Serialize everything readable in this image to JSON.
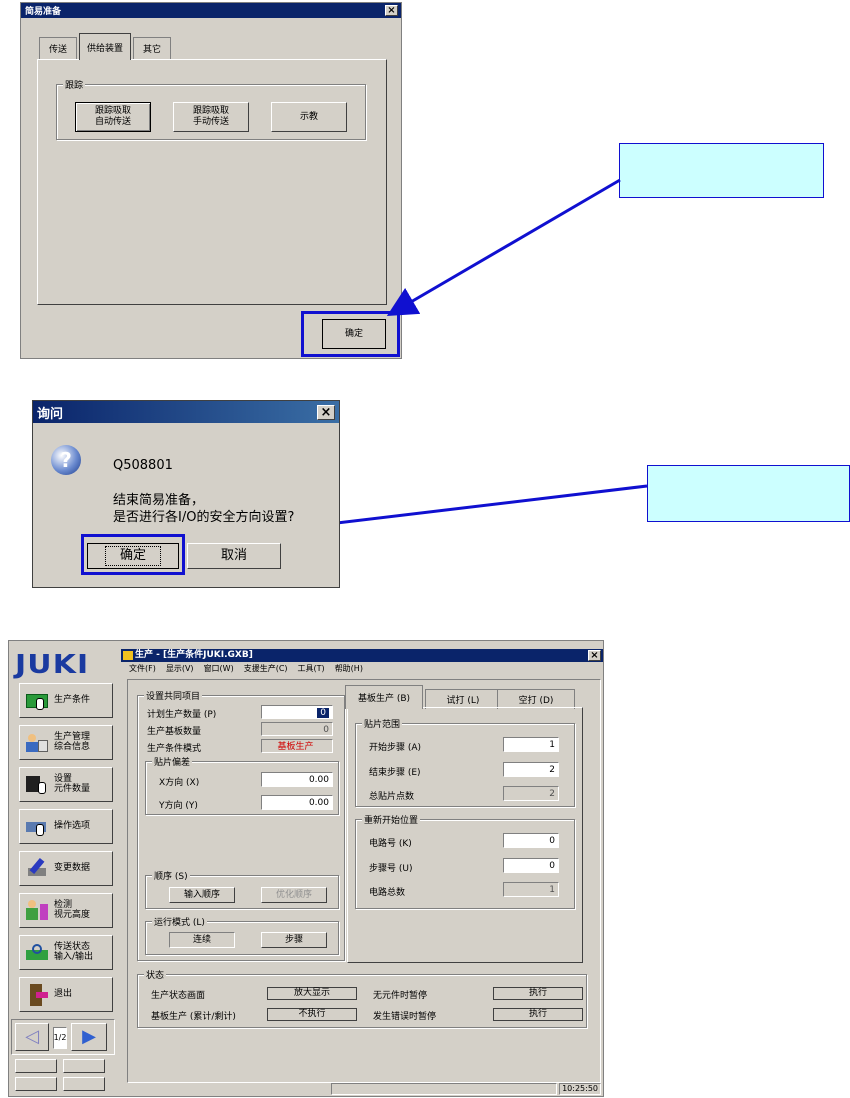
{
  "colors": {
    "title_bar": "#0a246a",
    "highlight": "#1010d0",
    "callout_bg": "#ccffff",
    "red_value": "#d00000"
  },
  "dialog1": {
    "title": "简易准备",
    "close": "×",
    "tabs": [
      "传送",
      "供给装置",
      "其它"
    ],
    "group_title": "跟踪",
    "buttons": [
      {
        "line1": "跟踪吸取",
        "line2": "自动传送"
      },
      {
        "line1": "跟踪吸取",
        "line2": "手动传送"
      },
      {
        "line1": "示教",
        "line2": ""
      }
    ],
    "ok_label": "确定"
  },
  "dialog2": {
    "title": "询问",
    "close": "×",
    "code": "Q508801",
    "message_line1": "结束简易准备，",
    "message_line2": "是否进行各I/O的安全方向设置?",
    "ok_label": "确定",
    "cancel_label": "取消",
    "question_icon": "?"
  },
  "main": {
    "logo": "JUKI",
    "title": "生产 - [生产条件JUKI.GXB]",
    "close": "×",
    "menu": [
      "文件(F)",
      "显示(V)",
      "窗口(W)",
      "支援生产(C)",
      "工具(T)",
      "帮助(H)"
    ],
    "sidebar": [
      {
        "label1": "生产条件",
        "label2": "",
        "icon": "production-icon"
      },
      {
        "label1": "生产管理",
        "label2": "综合信息",
        "icon": "management-icon"
      },
      {
        "label1": "设置",
        "label2": "元件数量",
        "icon": "parts-count-icon"
      },
      {
        "label1": "操作选项",
        "label2": "",
        "icon": "hand-option-icon"
      },
      {
        "label1": "变更数据",
        "label2": "",
        "icon": "edit-data-icon"
      },
      {
        "label1": "检测",
        "label2": "视元高度",
        "icon": "height-check-icon"
      },
      {
        "label1": "传送状态",
        "label2": "输入/输出",
        "icon": "io-status-icon"
      },
      {
        "label1": "退出",
        "label2": "",
        "icon": "exit-door-icon"
      }
    ],
    "page_indicator": "1/2",
    "common": {
      "title": "设置共同项目",
      "rows": [
        {
          "label": "计划生产数量 (P)",
          "value": "0"
        },
        {
          "label": "生产基板数量",
          "value": "0"
        },
        {
          "label": "生产条件模式",
          "value": "基板生产"
        }
      ]
    },
    "offset": {
      "title": "贴片偏差",
      "x_label": "X方向 (X)",
      "x_value": "0.00",
      "y_label": "Y方向 (Y)",
      "y_value": "0.00"
    },
    "order": {
      "title": "顺序 (S)",
      "input_label": "输入顺序",
      "optimize_label": "优化顺序"
    },
    "mode": {
      "title": "运行模式 (L)",
      "continuous": "连续",
      "step": "步骤"
    },
    "tabs": [
      "基板生产 (B)",
      "试打 (L)",
      "空打 (D)"
    ],
    "range": {
      "title": "贴片范围",
      "rows": [
        {
          "label": "开始步骤 (A)",
          "value": "1"
        },
        {
          "label": "结束步骤 (E)",
          "value": "2"
        },
        {
          "label": "总贴片点数",
          "value": "2"
        }
      ]
    },
    "restart": {
      "title": "重新开始位置",
      "rows": [
        {
          "label": "电路号 (K)",
          "value": "0"
        },
        {
          "label": "步骤号 (U)",
          "value": "0"
        },
        {
          "label": "电路总数",
          "value": "1"
        }
      ]
    },
    "status": {
      "title": "状态",
      "rows": [
        {
          "label1": "生产状态画面",
          "value1": "放大显示",
          "label2": "无元件时暂停",
          "value2": "执行"
        },
        {
          "label1": "基板生产 (累计/剩计)",
          "value1": "不执行",
          "label2": "发生错误时暂停",
          "value2": "执行"
        }
      ]
    },
    "clock": "10:25:50"
  }
}
